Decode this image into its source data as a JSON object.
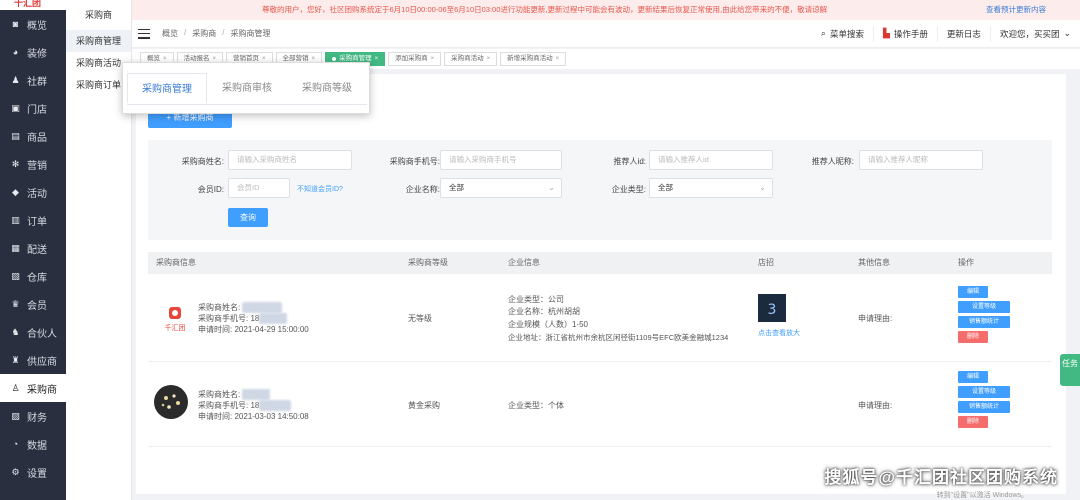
{
  "sidebar": {
    "logo": "千汇团",
    "items": [
      {
        "icon": "dashboard-icon",
        "glyph": "◙",
        "label": "概览"
      },
      {
        "icon": "palette-icon",
        "glyph": "◕",
        "label": "装修"
      },
      {
        "icon": "community-icon",
        "glyph": "♟",
        "label": "社群"
      },
      {
        "icon": "store-icon",
        "glyph": "▣",
        "label": "门店"
      },
      {
        "icon": "goods-icon",
        "glyph": "▤",
        "label": "商品"
      },
      {
        "icon": "marketing-icon",
        "glyph": "✻",
        "label": "营销"
      },
      {
        "icon": "tag-icon",
        "glyph": "◆",
        "label": "活动"
      },
      {
        "icon": "order-icon",
        "glyph": "▥",
        "label": "订单"
      },
      {
        "icon": "delivery-icon",
        "glyph": "▦",
        "label": "配送"
      },
      {
        "icon": "warehouse-icon",
        "glyph": "▧",
        "label": "仓库"
      },
      {
        "icon": "crown-icon",
        "glyph": "♛",
        "label": "会员"
      },
      {
        "icon": "partner-icon",
        "glyph": "♞",
        "label": "合伙人"
      },
      {
        "icon": "supplier-icon",
        "glyph": "♜",
        "label": "供应商"
      },
      {
        "icon": "buyer-icon",
        "glyph": "♙",
        "label": "采购商"
      },
      {
        "icon": "finance-icon",
        "glyph": "▨",
        "label": "财务"
      },
      {
        "icon": "data-icon",
        "glyph": "◔",
        "label": "数据"
      },
      {
        "icon": "settings-icon",
        "glyph": "⚙",
        "label": "设置"
      }
    ]
  },
  "subnav": {
    "title": "采购商",
    "items": [
      "采购商管理",
      "采购商活动",
      "采购商订单"
    ]
  },
  "notice": {
    "text": "尊敬的用户，您好，社区团购系统定于6月10日00:00-06至6月10日03:00进行功能更新,更新过程中可能会有波动，更新结果后恢复正常使用,由此给您带来的不便，敬请谅解",
    "more": "查看预计更新内容"
  },
  "header": {
    "crumbs": [
      "概览",
      "采购商",
      "采购商管理"
    ],
    "menu_search": "菜单搜索",
    "manual": "操作手册",
    "changelog": "更新日志",
    "welcome": "欢迎您，买买团"
  },
  "tags": [
    "概览",
    "活动报名",
    "营销首页",
    "全部营销",
    "采购商管理",
    "添加采购商",
    "采购商活动",
    "新增采购商活动"
  ],
  "tabs": [
    "采购商管理",
    "采购商审核",
    "采购商等级"
  ],
  "add_button": "+ 新增采购商",
  "filters": {
    "name_label": "采购商姓名:",
    "name_ph": "请输入采购商姓名",
    "phone_label": "采购商手机号:",
    "phone_ph": "请输入采购商手机号",
    "ref_id_label": "推荐人id:",
    "ref_id_ph": "请输入推荐人id",
    "ref_name_label": "推荐人昵称:",
    "ref_name_ph": "请输入推荐人昵称",
    "member_label": "会员ID:",
    "member_ph": "会员ID",
    "member_link": "不知道会员ID?",
    "company_label": "企业名称:",
    "company_val": "全部",
    "ctype_label": "企业类型:",
    "ctype_val": "全部",
    "query": "查询"
  },
  "table": {
    "headers": [
      "采购商信息",
      "采购商等级",
      "企业信息",
      "店招",
      "其他信息",
      "操作"
    ],
    "rows": [
      {
        "name_label": "采购商姓名:",
        "phone_label": "采购商手机号:",
        "phone": "18",
        "time_label": "申请时间:",
        "time": "2021-04-29 15:00:00",
        "level": "无等级",
        "company_type": "企业类型：公司",
        "company_name": "企业名称：杭州胡胡",
        "company_size": "企业规模（人数）1-50",
        "company_addr": "企业地址：浙江省杭州市余杭区闲径街1109号EFC欧美金融城1234",
        "sign_link": "点击查看放大",
        "other": "申请理由:",
        "ops": [
          "编辑",
          "设置等级",
          "销售额统计",
          "删除"
        ]
      },
      {
        "name_label": "采购商姓名:",
        "phone_label": "采购商手机号:",
        "phone": "18",
        "time_label": "申请时间:",
        "time": "2021-03-03 14:50:08",
        "level": "黄金采购",
        "company_type": "企业类型：个体",
        "other": "申请理由:",
        "ops": [
          "编辑",
          "设置等级",
          "销售额统计",
          "删除"
        ]
      }
    ]
  },
  "float_task": "任务",
  "watermark": "搜狐号@千汇团社区团购系统",
  "win_note": "转到\"设置\"以激活 Windows。"
}
